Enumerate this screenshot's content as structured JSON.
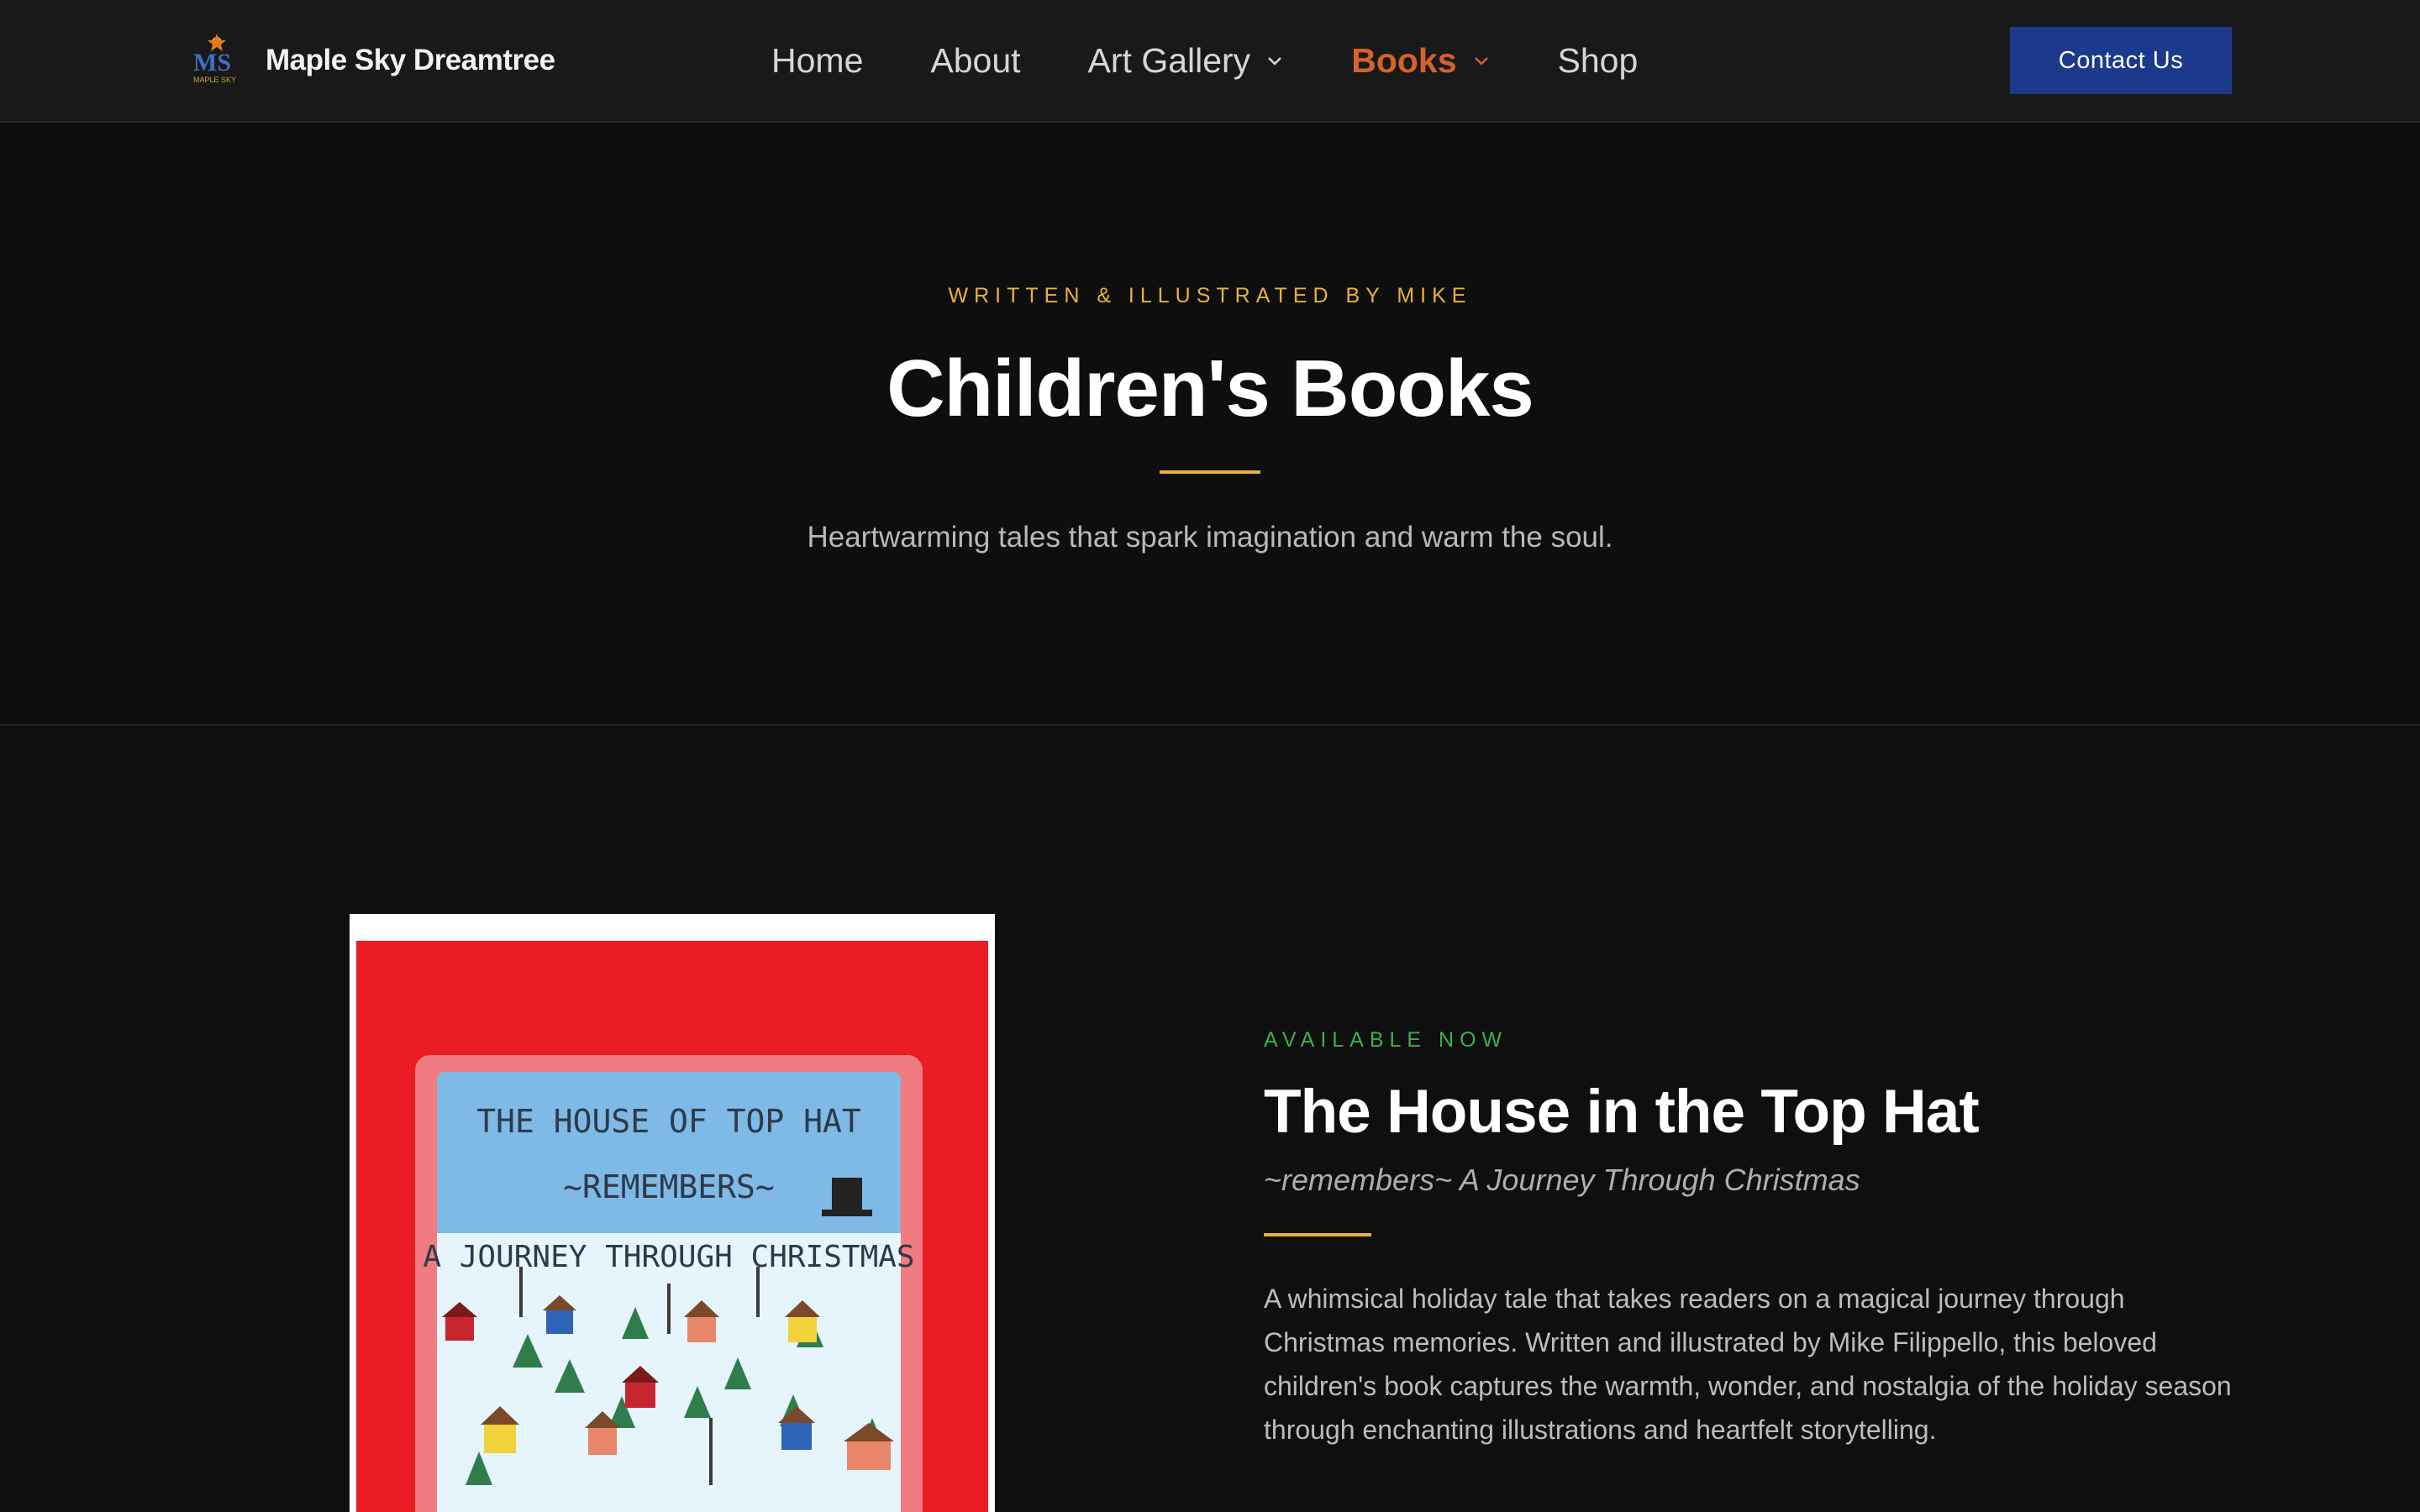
{
  "brand": {
    "name": "Maple Sky Dreamtree",
    "logo_text": "MS",
    "logo_subtext": "MAPLE SKY"
  },
  "nav": {
    "items": [
      {
        "label": "Home",
        "has_dropdown": false,
        "active": false
      },
      {
        "label": "About",
        "has_dropdown": false,
        "active": false
      },
      {
        "label": "Art Gallery",
        "has_dropdown": true,
        "active": false
      },
      {
        "label": "Books",
        "has_dropdown": true,
        "active": true
      },
      {
        "label": "Shop",
        "has_dropdown": false,
        "active": false
      }
    ],
    "contact_label": "Contact Us"
  },
  "hero": {
    "eyebrow": "WRITTEN & ILLUSTRATED BY MIKE",
    "title": "Children's Books",
    "subtitle": "Heartwarming tales that spark imagination and warm the soul."
  },
  "book": {
    "status": "AVAILABLE NOW",
    "title": "The House in the Top Hat",
    "subtitle": "~remembers~ A Journey Through Christmas",
    "description": "A whimsical holiday tale that takes readers on a magical journey through Christmas memories. Written and illustrated by Mike Filippello, this beloved children's book captures the warmth, wonder, and nostalgia of the holiday season through enchanting illustrations and heartfelt storytelling.",
    "cover_lines": [
      "THE HOUSE OF TOP HAT",
      "~REMEMBERS~",
      "A JOURNEY THROUGH CHRISTMAS"
    ]
  },
  "colors": {
    "accent_gold": "#e9b13a",
    "accent_green": "#3fae4f",
    "active_nav": "#d4622a",
    "contact_button": "#1c3a8c",
    "cover_red": "#ec1c24"
  }
}
